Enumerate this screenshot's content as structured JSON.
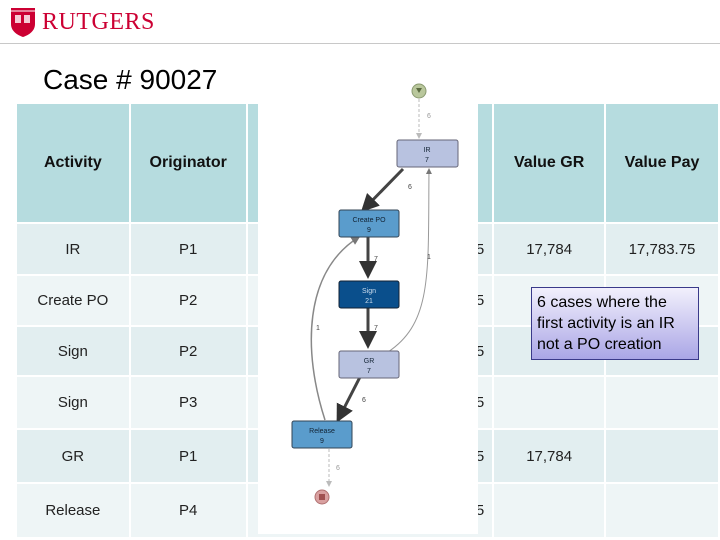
{
  "brand": {
    "name": "RUTGERS",
    "logo_icon": "shield-icon",
    "color": "#cc0033"
  },
  "title": "Case # 90027",
  "table": {
    "headers": [
      "Activity",
      "Originator",
      "",
      "Value GR",
      "Value Pay"
    ],
    "rows": [
      [
        "IR",
        "P1",
        "5",
        "17,784",
        "17,783.75"
      ],
      [
        "Create PO",
        "P2",
        "5",
        "",
        ""
      ],
      [
        "Sign",
        "P2",
        "5",
        "",
        ""
      ],
      [
        "Sign",
        "P3",
        "5",
        "",
        ""
      ],
      [
        "GR",
        "P1",
        "5",
        "17,784",
        ""
      ],
      [
        "Release",
        "P4",
        "5",
        "",
        ""
      ]
    ]
  },
  "graph": {
    "nodes": [
      {
        "label": "IR",
        "count": "7"
      },
      {
        "label": "Create PO",
        "count": "9"
      },
      {
        "label": "Sign",
        "count": "21"
      },
      {
        "label": "GR",
        "count": "7"
      },
      {
        "label": "Release",
        "count": "9"
      }
    ],
    "edges": {
      "start_ir": "6",
      "ir_po": "6",
      "po_sign": "7",
      "sign_gr": "7",
      "gr_ir": "1",
      "release_po": "1",
      "gr_release": "6",
      "release_end": "6"
    },
    "colors": {
      "light": "#b8c2e0",
      "mid": "#5a9ccc",
      "dark": "#0a4f8c"
    }
  },
  "callout": "6 cases where the first activity is an IR not a PO creation"
}
